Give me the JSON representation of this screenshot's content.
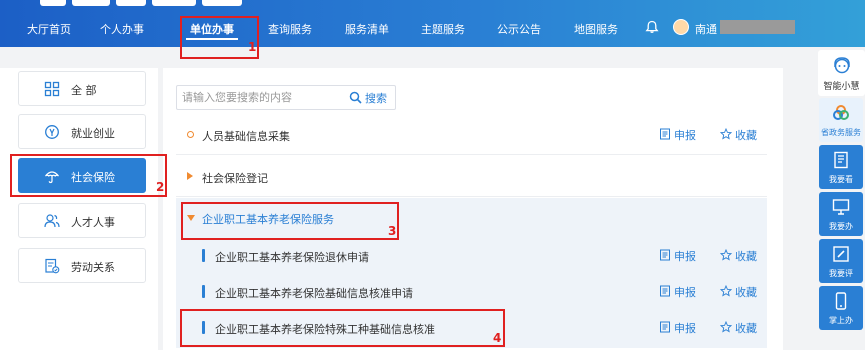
{
  "nav": {
    "items": [
      "大厅首页",
      "个人办事",
      "单位办事",
      "查询服务",
      "服务清单",
      "主题服务",
      "公示公告",
      "地图服务"
    ],
    "active": "单位办事",
    "user_name": "南通"
  },
  "sidebar": {
    "items": [
      {
        "label": "全 部",
        "icon": "grid-icon"
      },
      {
        "label": "就业创业",
        "icon": "badge-icon"
      },
      {
        "label": "社会保险",
        "icon": "umbrella-icon"
      },
      {
        "label": "人才人事",
        "icon": "people-icon"
      },
      {
        "label": "劳动关系",
        "icon": "document-icon"
      }
    ],
    "active": "社会保险"
  },
  "search": {
    "placeholder": "请输入您要搜索的内容",
    "button_label": "搜索"
  },
  "list": {
    "rows": [
      {
        "label": "人员基础信息采集",
        "apply": "申报",
        "favorite": "收藏"
      },
      {
        "label": "社会保险登记"
      },
      {
        "label": "企业职工基本养老保险服务"
      },
      {
        "label": "企业职工基本养老保险退休申请",
        "apply": "申报",
        "favorite": "收藏"
      },
      {
        "label": "企业职工基本养老保险基础信息核准申请",
        "apply": "申报",
        "favorite": "收藏"
      },
      {
        "label": "企业职工基本养老保险特殊工种基础信息核准",
        "apply": "申报",
        "favorite": "收藏"
      }
    ]
  },
  "annotations": [
    "1",
    "2",
    "3",
    "4"
  ],
  "right_toolbar": {
    "items": [
      "智能小慧",
      "省政务服务",
      "我要看",
      "我要办",
      "我要评",
      "掌上办"
    ]
  },
  "colors": {
    "primary": "#2a7fd4",
    "header_start": "#1c5fc6",
    "header_end": "#33a0d8",
    "accent_orange": "#f08a30",
    "annotation_red": "#e02020"
  }
}
